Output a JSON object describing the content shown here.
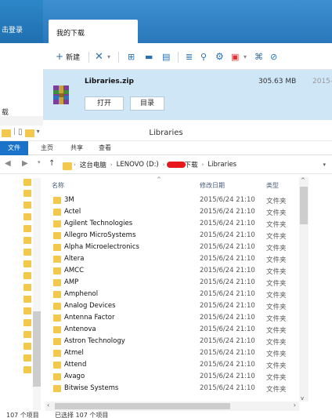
{
  "download_manager": {
    "sidebar": {
      "login_label": "击登录",
      "section_label": "载"
    },
    "tab_label": "我的下载",
    "toolbar": {
      "new_label": "新建"
    },
    "item": {
      "file_name": "Libraries.zip",
      "size": "305.63 MB",
      "date": "2015-",
      "open_label": "打开",
      "dir_label": "目录"
    }
  },
  "explorer": {
    "title": "Libraries",
    "ribbon_tabs": [
      "文件",
      "主页",
      "共享",
      "查看"
    ],
    "breadcrumb": [
      "这台电脑",
      "LENOVO (D:)",
      "下载",
      "Libraries"
    ],
    "columns": {
      "name": "名称",
      "date": "修改日期",
      "type": "类型"
    },
    "rows": [
      {
        "name": "3M",
        "date": "2015/6/24 21:10",
        "type": "文件夹"
      },
      {
        "name": "Actel",
        "date": "2015/6/24 21:10",
        "type": "文件夹"
      },
      {
        "name": "Agilent Technologies",
        "date": "2015/6/24 21:10",
        "type": "文件夹"
      },
      {
        "name": "Allegro MicroSystems",
        "date": "2015/6/24 21:10",
        "type": "文件夹"
      },
      {
        "name": "Alpha Microelectronics",
        "date": "2015/6/24 21:10",
        "type": "文件夹"
      },
      {
        "name": "Altera",
        "date": "2015/6/24 21:10",
        "type": "文件夹"
      },
      {
        "name": "AMCC",
        "date": "2015/6/24 21:10",
        "type": "文件夹"
      },
      {
        "name": "AMP",
        "date": "2015/6/24 21:10",
        "type": "文件夹"
      },
      {
        "name": "Amphenol",
        "date": "2015/6/24 21:10",
        "type": "文件夹"
      },
      {
        "name": "Analog Devices",
        "date": "2015/6/24 21:10",
        "type": "文件夹"
      },
      {
        "name": "Antenna Factor",
        "date": "2015/6/24 21:10",
        "type": "文件夹"
      },
      {
        "name": "Antenova",
        "date": "2015/6/24 21:10",
        "type": "文件夹"
      },
      {
        "name": "Astron Technology",
        "date": "2015/6/24 21:10",
        "type": "文件夹"
      },
      {
        "name": "Atmel",
        "date": "2015/6/24 21:10",
        "type": "文件夹"
      },
      {
        "name": "Attend",
        "date": "2015/6/24 21:10",
        "type": "文件夹"
      },
      {
        "name": "Avago",
        "date": "2015/6/24 21:10",
        "type": "文件夹"
      },
      {
        "name": "Bitwise Systems",
        "date": "2015/6/24 21:10",
        "type": "文件夹"
      }
    ],
    "status": {
      "count": "107 个项目",
      "selected": "已选择 107 个项目"
    }
  },
  "colors": {
    "accent": "#1a73c8",
    "folder": "#f2c94c",
    "selection": "#cfe6f7"
  }
}
